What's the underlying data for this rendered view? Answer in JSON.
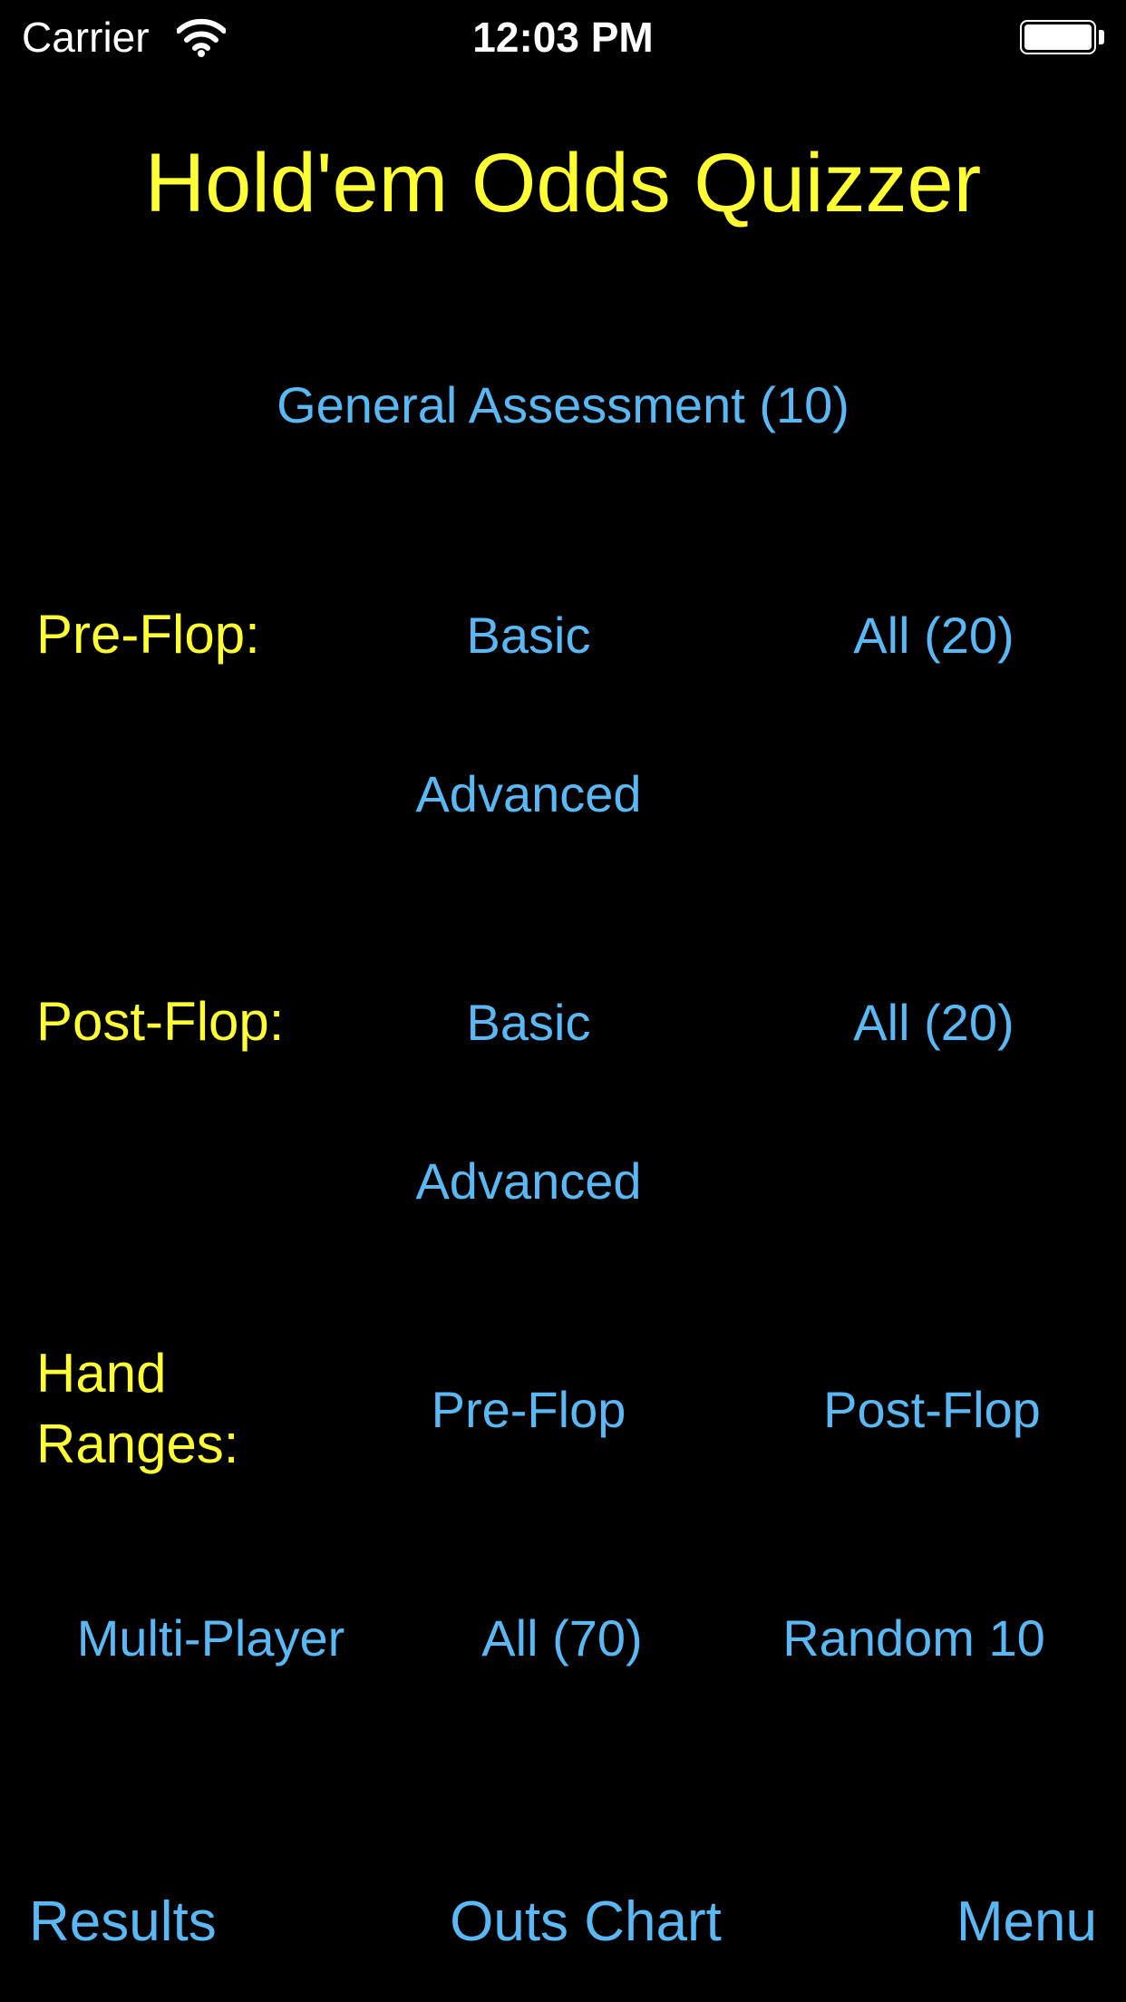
{
  "status_bar": {
    "carrier": "Carrier",
    "time": "12:03 PM",
    "wifi_icon": "wifi-icon",
    "battery_icon": "battery-icon"
  },
  "title": "Hold'em Odds Quizzer",
  "general": {
    "label": "General Assessment (10)"
  },
  "pre_flop": {
    "heading": "Pre-Flop:",
    "basic": "Basic",
    "all": "All (20)",
    "advanced": "Advanced"
  },
  "post_flop": {
    "heading": "Post-Flop:",
    "basic": "Basic",
    "all": "All (20)",
    "advanced": "Advanced"
  },
  "hand_ranges": {
    "heading_line1": "Hand",
    "heading_line2": "Ranges:",
    "pre_flop": "Pre-Flop",
    "post_flop": "Post-Flop"
  },
  "extras": {
    "multi_player": "Multi-Player",
    "all": "All (70)",
    "random": "Random 10"
  },
  "bottom_bar": {
    "results": "Results",
    "outs_chart": "Outs Chart",
    "menu": "Menu"
  },
  "colors": {
    "background": "#000000",
    "heading": "#FFFF33",
    "link": "#5AB8F5"
  }
}
